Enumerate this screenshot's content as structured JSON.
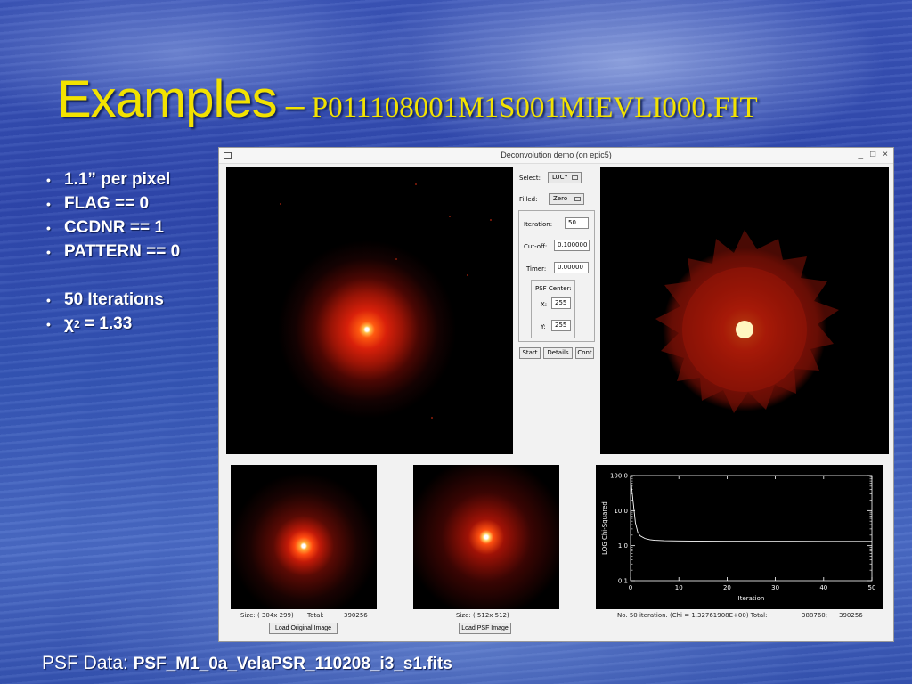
{
  "slide": {
    "title": "Examples",
    "dash": "–",
    "filename": "P011108001M1S001MIEVLI000.FIT",
    "bullets": [
      "1.1” per pixel",
      "FLAG == 0",
      "CCDNR == 1",
      "PATTERN == 0"
    ],
    "bullets2": [
      "50 Iterations"
    ],
    "chi_symbol": "χ",
    "chi_sup": "2",
    "chi_value": "= 1.33",
    "bullet_glyph": "•",
    "psf_label": "PSF Data:",
    "psf_file": "PSF_M1_0a_VelaPSR_110208_i3_s1.fits"
  },
  "window": {
    "title": "Deconvolution demo (on epic5)",
    "minimize": "_",
    "maximize": "□",
    "close": "×"
  },
  "controls": {
    "select_label": "Select:",
    "select_value": "LUCY",
    "filled_label": "Filled:",
    "filled_value": "Zero",
    "iteration_label": "Iteration:",
    "iteration_value": "50",
    "cutoff_label": "Cut-off:",
    "cutoff_value": "0.100000",
    "timer_label": "Timer:",
    "timer_value": "0.00000",
    "psf_center_label": "PSF Center:",
    "x_label": "X:",
    "x_value": "255",
    "y_label": "Y:",
    "y_value": "255",
    "start": "Start",
    "details": "Details",
    "cont": "Cont"
  },
  "bottom": {
    "orig_size": "Size: ( 304x 299)",
    "orig_total_label": "Total:",
    "orig_total": "390256",
    "load_original": "Load Original Image",
    "psf_size": "Size: ( 512x 512)",
    "load_psf": "Load PSF Image",
    "status": "No.    50 iteration. (Chi = 1.32761908E+00) Total:",
    "status_total1": "388760;",
    "status_total2": "390256"
  },
  "chart_data": {
    "type": "line",
    "xlabel": "Iteration",
    "ylabel": "LOG Chi-Squared",
    "xlim": [
      0,
      50
    ],
    "ylim": [
      0.1,
      100
    ],
    "yscale": "log",
    "xticks": [
      "0",
      "10",
      "20",
      "30",
      "40",
      "50"
    ],
    "yticks": [
      "100.0",
      "10.0",
      "1.0",
      "0.1"
    ],
    "background": "#000000",
    "line_color": "#ffffff",
    "x": [
      0,
      0.5,
      1,
      1.5,
      2,
      3,
      4,
      5,
      7,
      10,
      15,
      20,
      30,
      40,
      50
    ],
    "y": [
      90,
      20,
      4.5,
      2.4,
      1.9,
      1.6,
      1.48,
      1.43,
      1.39,
      1.37,
      1.35,
      1.34,
      1.335,
      1.33,
      1.33
    ]
  }
}
